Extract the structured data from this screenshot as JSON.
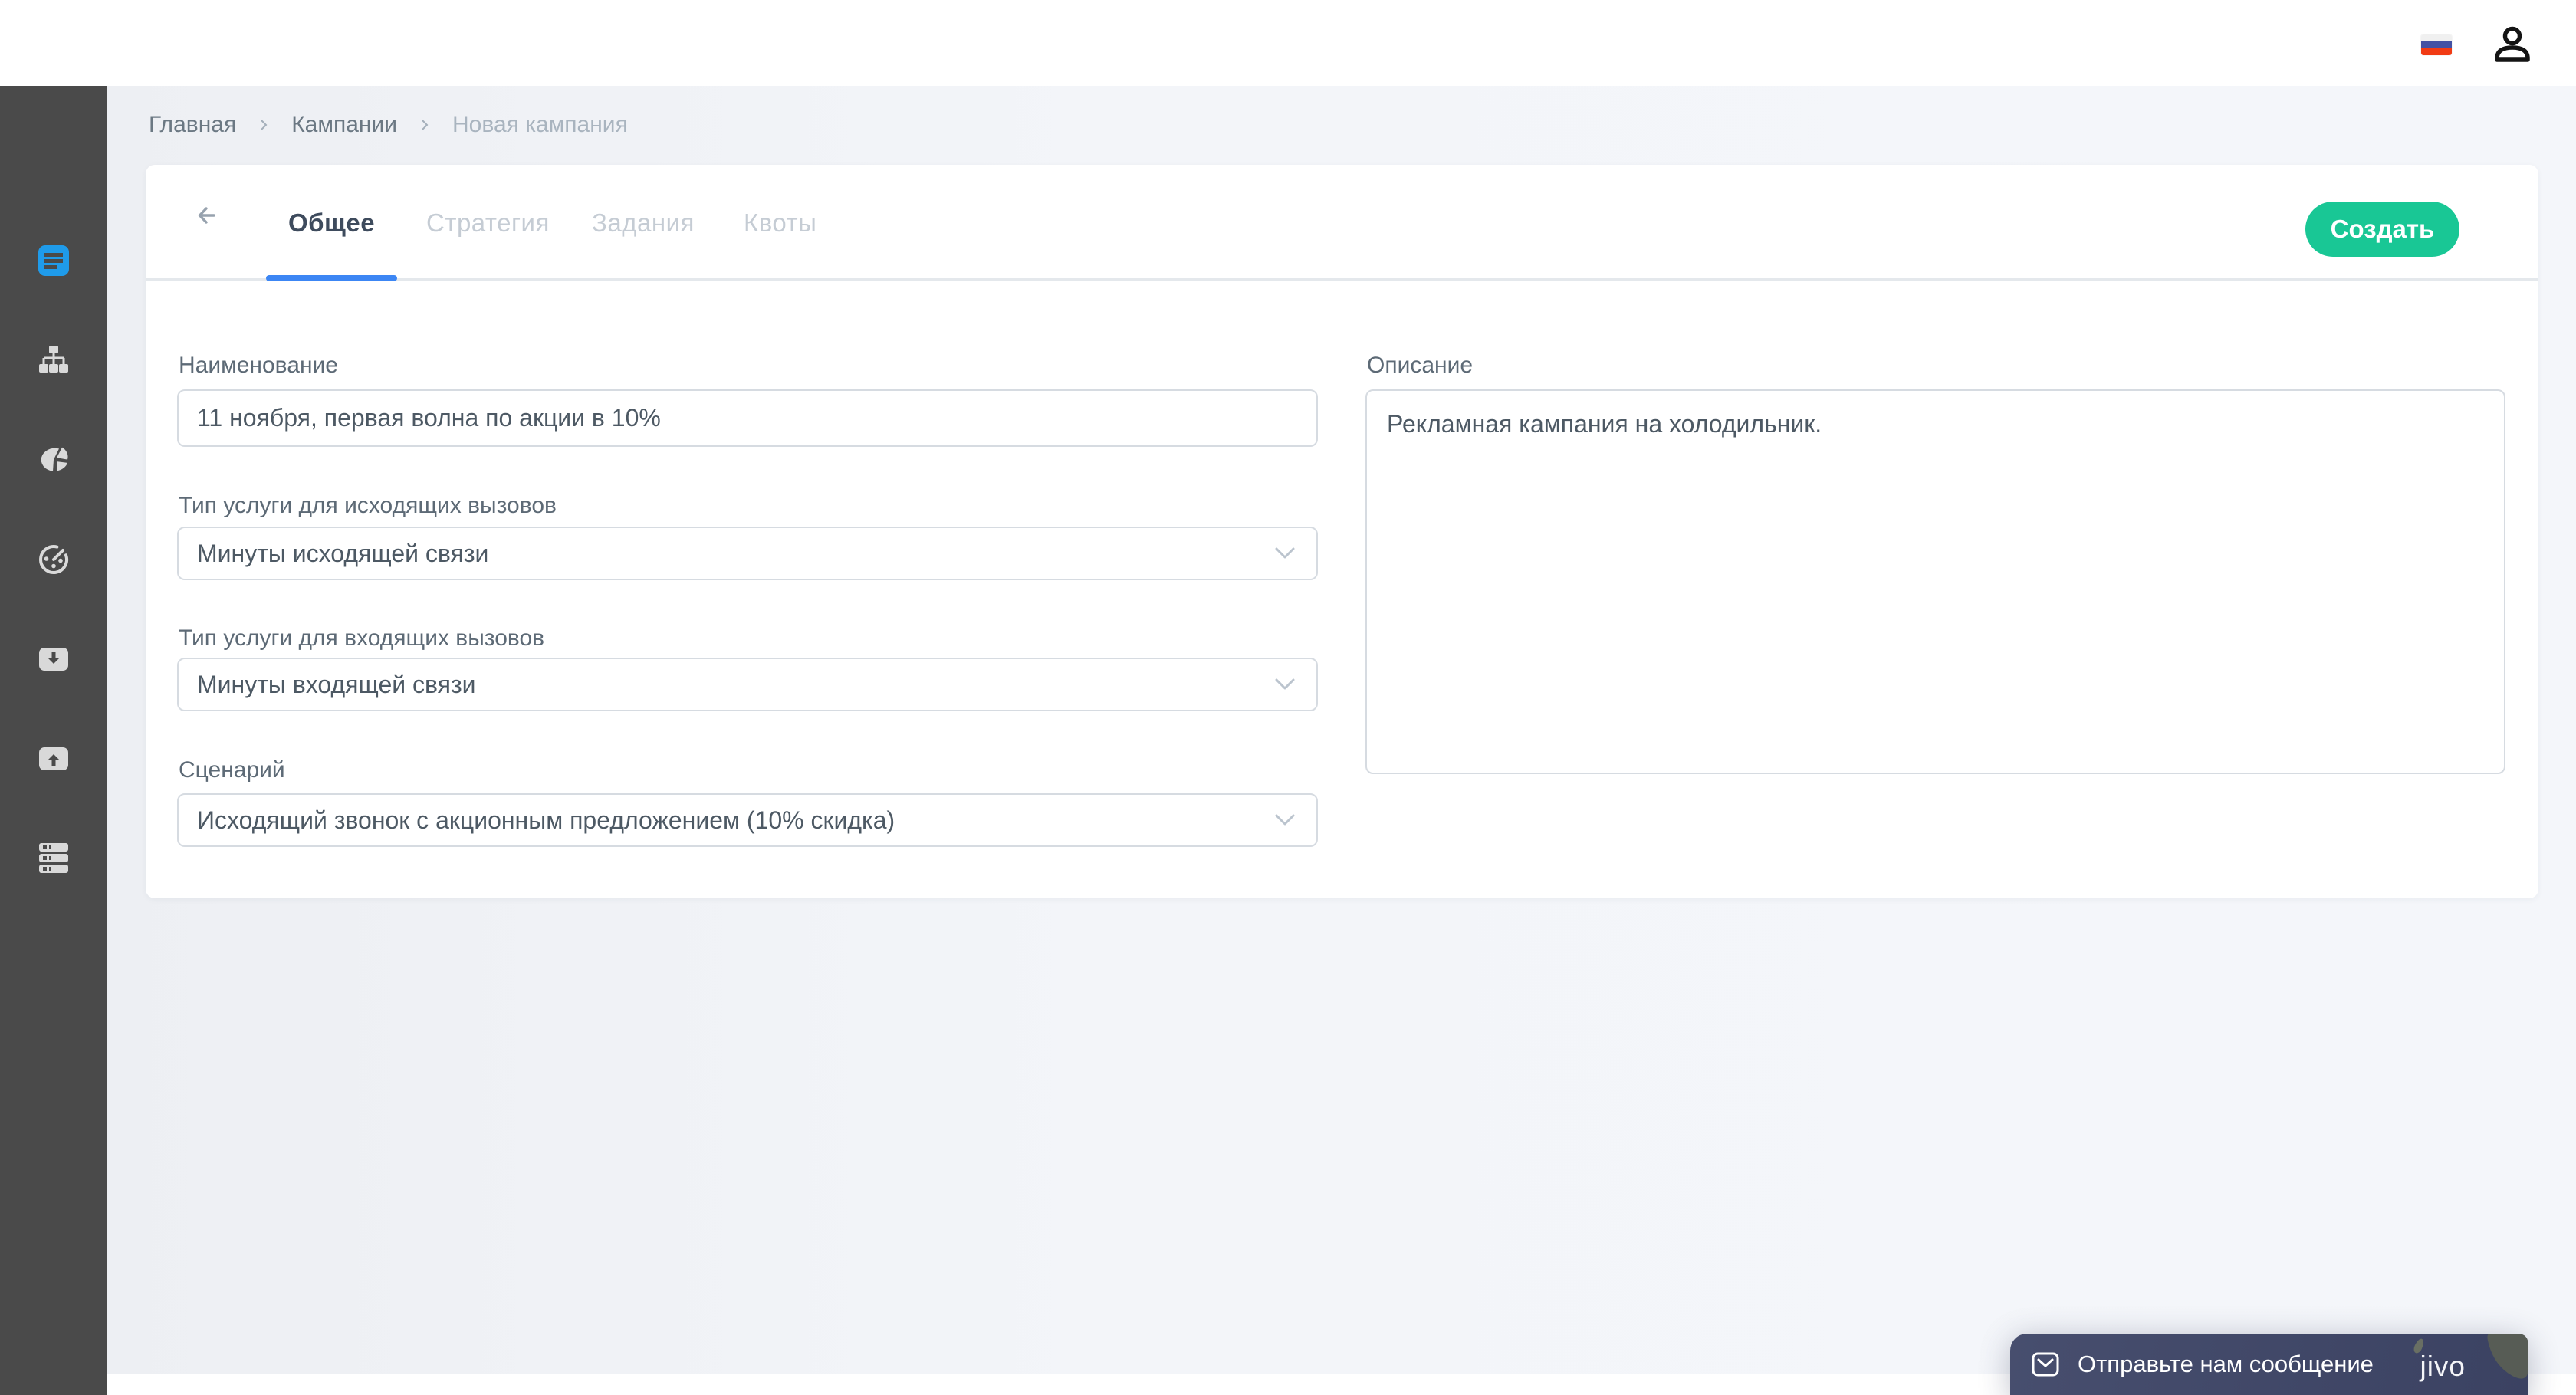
{
  "topbar": {
    "language_flag": "russian-flag",
    "user_icon": "user-icon"
  },
  "breadcrumb": {
    "items": [
      {
        "label": "Главная",
        "current": false
      },
      {
        "label": "Кампании",
        "current": false
      },
      {
        "label": "Новая кампания",
        "current": true
      }
    ]
  },
  "header": {
    "back_icon": "arrow-left-icon",
    "tabs": [
      {
        "label": "Общее",
        "active": true
      },
      {
        "label": "Стратегия",
        "active": false
      },
      {
        "label": "Задания",
        "active": false
      },
      {
        "label": "Квоты",
        "active": false
      }
    ],
    "create_button": "Создать"
  },
  "form": {
    "name": {
      "label": "Наименование",
      "value": "11 ноября, первая волна по акции в 10%"
    },
    "outgoing_service": {
      "label": "Тип услуги для исходящих вызовов",
      "value": "Минуты исходящей связи"
    },
    "incoming_service": {
      "label": "Тип услуги для входящих вызовов",
      "value": "Минуты входящей связи"
    },
    "scenario": {
      "label": "Сценарий",
      "value": "Исходящий звонок с акционным предложением (10% скидка)"
    },
    "description": {
      "label": "Описание",
      "value": "Рекламная кампания на холодильник."
    }
  },
  "sidebar": {
    "active_index": 0,
    "icons": [
      "feed-icon",
      "sitemap-icon",
      "pie-chart-icon",
      "timer-icon",
      "inbox-down-icon",
      "inbox-up-icon",
      "server-icon"
    ]
  },
  "chat_widget": {
    "message": "Отправьте нам сообщение",
    "brand": "jivo",
    "envelope_icon": "envelope-icon"
  },
  "colors": {
    "accent_green": "#19C795",
    "accent_blue": "#3C86F4",
    "sidebar_bg": "#4A4A4A",
    "sidebar_active_icon": "#1F9BEA",
    "page_bg": "#F1F3F7",
    "chat_bg": "#3E4564"
  }
}
